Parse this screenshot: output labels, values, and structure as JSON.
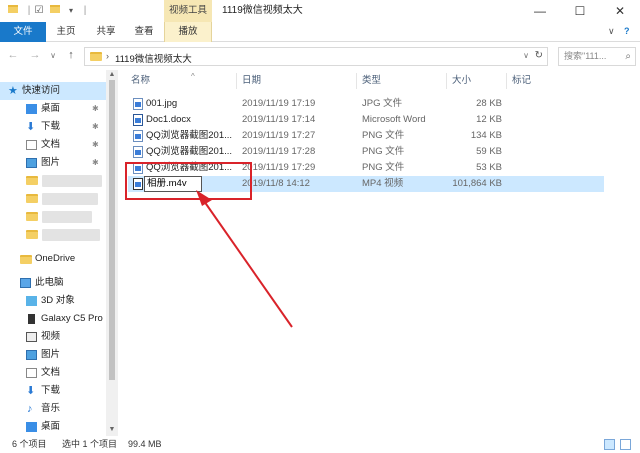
{
  "window": {
    "title": "1119微信视频太大",
    "context_tab": "视频工具",
    "minimize": "—",
    "maximize": "☐",
    "close": "✕"
  },
  "ribbon": {
    "tabs": [
      {
        "label": "文件"
      },
      {
        "label": "主页"
      },
      {
        "label": "共享"
      },
      {
        "label": "查看"
      },
      {
        "label": "播放"
      }
    ],
    "collapse": "∨",
    "help": "?"
  },
  "address": {
    "back": "←",
    "forward": "→",
    "recent": "∨",
    "up": "↑",
    "separator": "›",
    "path": "1119微信视频太大",
    "dropdown": "∨",
    "refresh": "↻",
    "search_placeholder": "搜索\"111...",
    "search_icon": "⌕"
  },
  "nav": {
    "quick_access": "快速访问",
    "pinned": [
      {
        "label": "桌面",
        "icon": "desktop-icon"
      },
      {
        "label": "下载",
        "icon": "download-icon"
      },
      {
        "label": "文档",
        "icon": "documents-icon"
      },
      {
        "label": "图片",
        "icon": "pictures-icon"
      }
    ],
    "pin_glyph": "📌",
    "onedrive": "OneDrive",
    "this_pc": "此电脑",
    "pc_items": [
      {
        "label": "3D 对象",
        "icon": "3d-objects-icon"
      },
      {
        "label": "Galaxy C5 Pro",
        "icon": "phone-icon"
      },
      {
        "label": "视频",
        "icon": "videos-icon"
      },
      {
        "label": "图片",
        "icon": "pictures-icon"
      },
      {
        "label": "文档",
        "icon": "documents-icon"
      },
      {
        "label": "下载",
        "icon": "download-icon"
      },
      {
        "label": "音乐",
        "icon": "music-icon"
      },
      {
        "label": "桌面",
        "icon": "desktop-icon"
      }
    ]
  },
  "columns": {
    "name": "名称",
    "date": "日期",
    "type": "类型",
    "size": "大小",
    "tags": "标记"
  },
  "files": [
    {
      "name": "001.jpg",
      "date": "2019/11/19 17:19",
      "type": "JPG 文件",
      "size": "28 KB"
    },
    {
      "name": "Doc1.docx",
      "date": "2019/11/19 17:14",
      "type": "Microsoft Word",
      "size": "12 KB"
    },
    {
      "name": "QQ浏览器截图201...",
      "date": "2019/11/19 17:27",
      "type": "PNG 文件",
      "size": "134 KB"
    },
    {
      "name": "QQ浏览器截图201...",
      "date": "2019/11/19 17:28",
      "type": "PNG 文件",
      "size": "59 KB"
    },
    {
      "name": "QQ浏览器截图201...",
      "date": "2019/11/19 17:29",
      "type": "PNG 文件",
      "size": "53 KB"
    },
    {
      "name": "相册.m4v",
      "date": "2019/11/8 14:12",
      "type": "MP4 视频",
      "size": "101,864 KB"
    }
  ],
  "status": {
    "count": "6 个项目",
    "selected": "选中 1 个项目",
    "size": "99.4 MB"
  },
  "colors": {
    "annotation": "#d9232a",
    "selection": "#cce8ff",
    "file_tab": "#1979ca"
  }
}
